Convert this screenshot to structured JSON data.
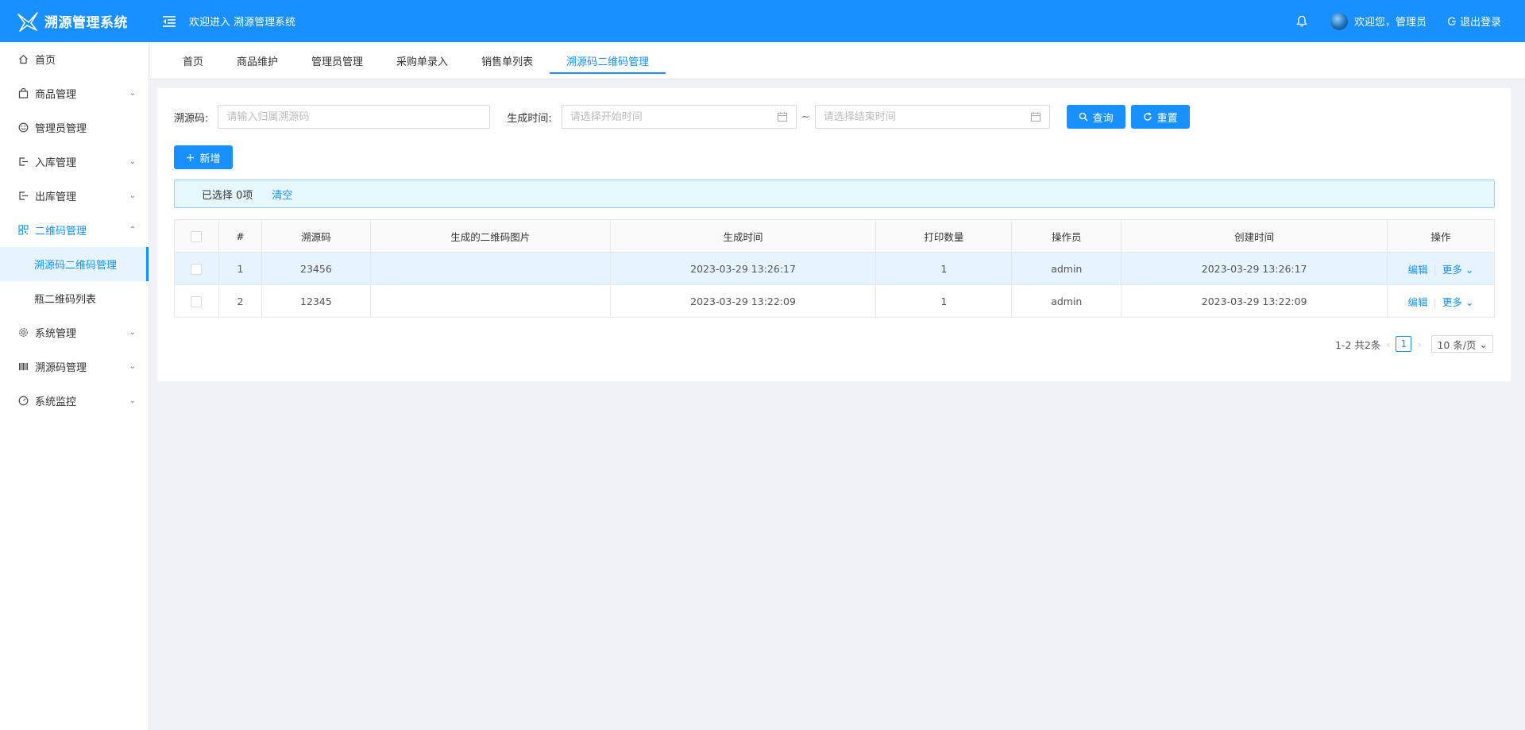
{
  "header": {
    "app_title": "溯源管理系统",
    "welcome": "欢迎进入 溯源管理系统",
    "user_greeting": "欢迎您，管理员",
    "logout": "退出登录"
  },
  "sidebar": {
    "items": [
      {
        "label": "首页",
        "icon": "home-icon"
      },
      {
        "label": "商品管理",
        "icon": "shopping-bag-icon"
      },
      {
        "label": "管理员管理",
        "icon": "smile-icon"
      },
      {
        "label": "入库管理",
        "icon": "import-icon"
      },
      {
        "label": "出库管理",
        "icon": "export-icon"
      },
      {
        "label": "二维码管理",
        "icon": "qrcode-icon"
      },
      {
        "label": "系统管理",
        "icon": "gear-icon"
      },
      {
        "label": "溯源码管理",
        "icon": "barcode-icon"
      },
      {
        "label": "系统监控",
        "icon": "dashboard-icon"
      }
    ],
    "sub_items": [
      {
        "label": "溯源码二维码管理"
      },
      {
        "label": "瓶二维码列表"
      }
    ]
  },
  "tabs": [
    {
      "label": "首页"
    },
    {
      "label": "商品维护"
    },
    {
      "label": "管理员管理"
    },
    {
      "label": "采购单录入"
    },
    {
      "label": "销售单列表"
    },
    {
      "label": "溯源码二维码管理"
    }
  ],
  "search": {
    "code_label": "溯源码:",
    "code_placeholder": "请输入归属溯源码",
    "time_label": "生成时间:",
    "start_placeholder": "请选择开始时间",
    "end_placeholder": "请选择结束时间",
    "tilde": "~",
    "query": "查询",
    "reset": "重置"
  },
  "actions": {
    "add": "新增"
  },
  "selection": {
    "text": "已选择 0项",
    "clear": "清空"
  },
  "table": {
    "headers": [
      "#",
      "溯源码",
      "生成的二维码图片",
      "生成时间",
      "打印数量",
      "操作员",
      "创建时间",
      "操作"
    ],
    "rows": [
      {
        "idx": "1",
        "code": "23456",
        "image": "",
        "gen_time": "2023-03-29 13:26:17",
        "count": "1",
        "operator": "admin",
        "created": "2023-03-29 13:26:17"
      },
      {
        "idx": "2",
        "code": "12345",
        "image": "",
        "gen_time": "2023-03-29 13:22:09",
        "count": "1",
        "operator": "admin",
        "created": "2023-03-29 13:22:09"
      }
    ],
    "edit": "编辑",
    "more": "更多"
  },
  "pagination": {
    "summary": "1-2 共2条",
    "current": "1",
    "page_size": "10 条/页"
  },
  "colors": {
    "primary": "#1890ff",
    "highlight_row": "#e6f4ff",
    "alert_bg": "#e6f7ff"
  }
}
